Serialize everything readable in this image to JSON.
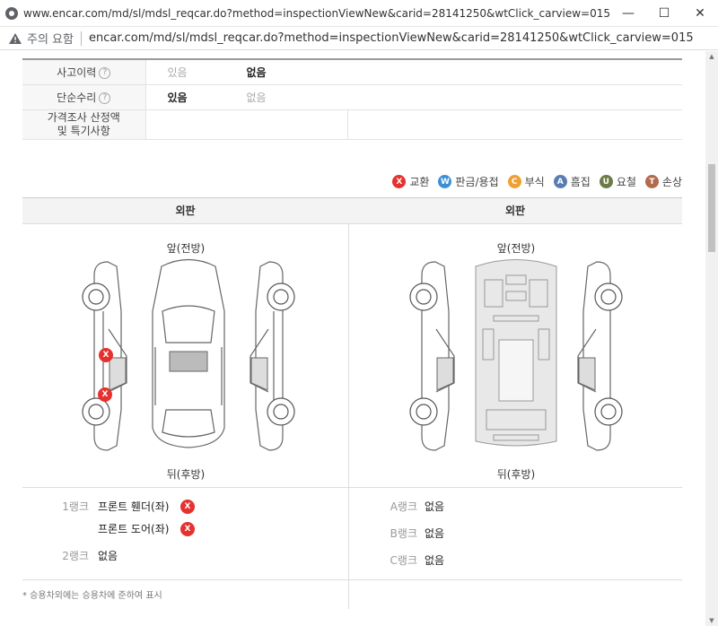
{
  "window": {
    "title": "www.encar.com/md/sl/mdsl_reqcar.do?method=inspectionViewNew&carid=28141250&wtClick_carview=015 - Chrome",
    "minimize": "—",
    "maximize": "☐",
    "close": "✕"
  },
  "address": {
    "warning": "주의 요함",
    "url": "encar.com/md/sl/mdsl_reqcar.do?method=inspectionViewNew&carid=28141250&wtClick_carview=015"
  },
  "info": {
    "rows": [
      {
        "label": "사고이력",
        "opt1": "있음",
        "opt2": "없음"
      },
      {
        "label": "단순수리",
        "opt1": "있음",
        "opt2": "없음"
      }
    ],
    "price_label": "가격조사 산정액\n및 특기사항",
    "help": "?"
  },
  "legend": [
    {
      "code": "X",
      "label": "교환",
      "color": "#e5322e"
    },
    {
      "code": "W",
      "label": "판금/용접",
      "color": "#3a8fd8"
    },
    {
      "code": "C",
      "label": "부식",
      "color": "#f0a030"
    },
    {
      "code": "A",
      "label": "흠집",
      "color": "#5a7cb0"
    },
    {
      "code": "U",
      "label": "요철",
      "color": "#6b7a46"
    },
    {
      "code": "T",
      "label": "손상",
      "color": "#b36a4c"
    }
  ],
  "panels": {
    "left_title": "외판",
    "right_title": "외판",
    "front": "앞(전방)",
    "rear": "뒤(후방)"
  },
  "left_ranks": {
    "rank1_label": "1랭크",
    "rank1_item1": "프론트 휀더(좌)",
    "rank1_item2": "프론트 도어(좌)",
    "rank2_label": "2랭크",
    "rank2_value": "없음",
    "mark": "X"
  },
  "right_ranks": {
    "a_label": "A랭크",
    "a_value": "없음",
    "b_label": "B랭크",
    "b_value": "없음",
    "c_label": "C랭크",
    "c_value": "없음"
  },
  "note": "* 승용차외에는 승용차에 준하여 표시"
}
